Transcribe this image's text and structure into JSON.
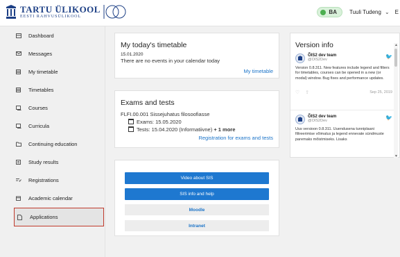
{
  "header": {
    "logo_name": "TARTU ÜLIKOOL",
    "logo_sub": "EESTI RAHVUSÜLIKOOL",
    "badge": "BA",
    "user_name": "Tuuli Tudeng",
    "chevron": "⌄",
    "lang": "E"
  },
  "sidebar": {
    "items": [
      {
        "label": "Dashboard",
        "icon": "dashboard-icon"
      },
      {
        "label": "Messages",
        "icon": "envelope-icon"
      },
      {
        "label": "My timetable",
        "icon": "calendar-grid-icon"
      },
      {
        "label": "Timetables",
        "icon": "calendar-grid-icon"
      },
      {
        "label": "Courses",
        "icon": "book-icon"
      },
      {
        "label": "Curricula",
        "icon": "book-icon"
      },
      {
        "label": "Continuing education",
        "icon": "folder-icon"
      },
      {
        "label": "Study results",
        "icon": "list-icon"
      },
      {
        "label": "Registrations",
        "icon": "check-list-icon"
      },
      {
        "label": "Academic calendar",
        "icon": "calendar-icon"
      },
      {
        "label": "Applications",
        "icon": "document-icon"
      }
    ],
    "active_index": 10
  },
  "timetable": {
    "title": "My today's timetable",
    "date": "15.01.2020",
    "message": "There are no events in your calendar today",
    "link": "My timetable"
  },
  "exams": {
    "title": "Exams and tests",
    "course": "FLFI.00.001 Sissejuhatus filosoofiasse",
    "exams_line": "Exams: 15.05.2020",
    "tests_line": "Tests: 15.04.2020 (Informatiivne)",
    "more": "+ 1 more",
    "link": "Registration for exams and tests"
  },
  "links": {
    "video": "Video about SIS",
    "info": "SIS info and help",
    "moodle": "Moodle",
    "intranet": "Intranet"
  },
  "version": {
    "title": "Version info",
    "tweets": [
      {
        "name": "ÕIS2 dev team",
        "handle": "@OIS2Dev",
        "body": "Version 0.8.311. New features include legend and filters for timetables, courses can be opened in a new (or modal) window. Bug fixes and performance updates.",
        "date": "Sep 25, 2019"
      },
      {
        "name": "ÕIS2 dev team",
        "handle": "@OIS2Dev",
        "body": "Uus versioon 0.8.311. Uuendusena tunniplaani filtreerimise võimalus ja legend ennevate sündmuste paremaks mõistmiseks. Lisaks",
        "date": ""
      }
    ]
  },
  "colors": {
    "accent": "#1e78d0",
    "brand": "#1c3f85",
    "active_border": "#c0392b",
    "badge_bg": "#d9f1da"
  }
}
